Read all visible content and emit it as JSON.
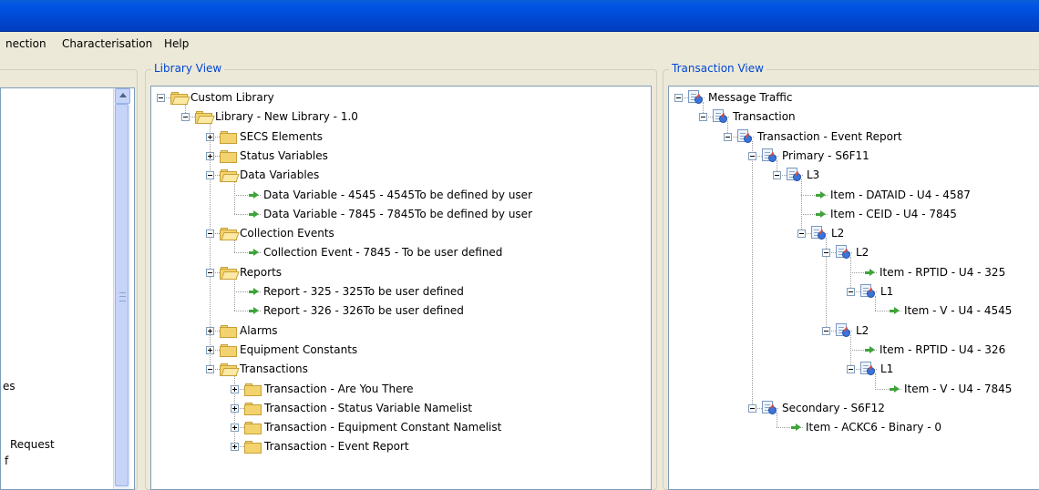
{
  "menu": [
    "nection",
    "Characterisation",
    "Help"
  ],
  "left_panel": {
    "partial_items": [
      "es",
      "Request",
      "f"
    ]
  },
  "library": {
    "title": "Library View",
    "nodes": [
      {
        "label": "Custom Library",
        "depth": 0,
        "icon": "folder-open",
        "expander": "minus"
      },
      {
        "label": "Library - New Library - 1.0",
        "depth": 1,
        "icon": "folder-open",
        "expander": "minus"
      },
      {
        "label": "SECS Elements",
        "depth": 2,
        "icon": "folder",
        "expander": "plus"
      },
      {
        "label": "Status Variables",
        "depth": 2,
        "icon": "folder",
        "expander": "plus"
      },
      {
        "label": "Data Variables",
        "depth": 2,
        "icon": "folder-open",
        "expander": "minus"
      },
      {
        "label": "Data Variable - 4545 - 4545To be defined by user",
        "depth": 3,
        "icon": "arrow",
        "expander": "none"
      },
      {
        "label": "Data Variable - 7845 - 7845To be defined by user",
        "depth": 3,
        "icon": "arrow",
        "expander": "none"
      },
      {
        "label": "Collection Events",
        "depth": 2,
        "icon": "folder-open",
        "expander": "minus"
      },
      {
        "label": "Collection Event - 7845 - To be user defined",
        "depth": 3,
        "icon": "arrow",
        "expander": "none"
      },
      {
        "label": "Reports",
        "depth": 2,
        "icon": "folder-open",
        "expander": "minus"
      },
      {
        "label": "Report - 325 - 325To be user defined",
        "depth": 3,
        "icon": "arrow",
        "expander": "none"
      },
      {
        "label": "Report - 326 - 326To be user defined",
        "depth": 3,
        "icon": "arrow",
        "expander": "none"
      },
      {
        "label": "Alarms",
        "depth": 2,
        "icon": "folder",
        "expander": "plus"
      },
      {
        "label": "Equipment Constants",
        "depth": 2,
        "icon": "folder",
        "expander": "plus"
      },
      {
        "label": "Transactions",
        "depth": 2,
        "icon": "folder-open",
        "expander": "minus"
      },
      {
        "label": "Transaction - Are You There",
        "depth": 3,
        "icon": "folder",
        "expander": "plus"
      },
      {
        "label": "Transaction - Status Variable Namelist",
        "depth": 3,
        "icon": "folder",
        "expander": "plus"
      },
      {
        "label": "Transaction - Equipment Constant Namelist",
        "depth": 3,
        "icon": "folder",
        "expander": "plus"
      },
      {
        "label": "Transaction - Event Report",
        "depth": 3,
        "icon": "folder",
        "expander": "plus"
      }
    ]
  },
  "transaction": {
    "title": "Transaction View",
    "nodes": [
      {
        "label": "Message Traffic",
        "depth": 0,
        "icon": "message",
        "expander": "minus"
      },
      {
        "label": "Transaction",
        "depth": 1,
        "icon": "message",
        "expander": "minus"
      },
      {
        "label": "Transaction - Event Report",
        "depth": 2,
        "icon": "message",
        "expander": "minus"
      },
      {
        "label": "Primary - S6F11",
        "depth": 3,
        "icon": "message",
        "expander": "minus"
      },
      {
        "label": "L3",
        "depth": 4,
        "icon": "message",
        "expander": "minus"
      },
      {
        "label": "Item - DATAID - U4 - 4587",
        "depth": 5,
        "icon": "arrow",
        "expander": "none"
      },
      {
        "label": "Item - CEID - U4 - 7845",
        "depth": 5,
        "icon": "arrow",
        "expander": "none"
      },
      {
        "label": "L2",
        "depth": 5,
        "icon": "message",
        "expander": "minus"
      },
      {
        "label": "L2",
        "depth": 6,
        "icon": "message",
        "expander": "minus"
      },
      {
        "label": "Item - RPTID - U4 - 325",
        "depth": 7,
        "icon": "arrow",
        "expander": "none"
      },
      {
        "label": "L1",
        "depth": 7,
        "icon": "message",
        "expander": "minus"
      },
      {
        "label": "Item - V - U4 - 4545",
        "depth": 8,
        "icon": "arrow",
        "expander": "none"
      },
      {
        "label": "L2",
        "depth": 6,
        "icon": "message",
        "expander": "minus"
      },
      {
        "label": "Item - RPTID - U4 - 326",
        "depth": 7,
        "icon": "arrow",
        "expander": "none"
      },
      {
        "label": "L1",
        "depth": 7,
        "icon": "message",
        "expander": "minus"
      },
      {
        "label": "Item - V - U4 - 7845",
        "depth": 8,
        "icon": "arrow",
        "expander": "none"
      },
      {
        "label": "Secondary - S6F12",
        "depth": 3,
        "icon": "message",
        "expander": "minus"
      },
      {
        "label": "Item - ACKC6 - Binary - 0",
        "depth": 4,
        "icon": "arrow",
        "expander": "none"
      }
    ]
  }
}
